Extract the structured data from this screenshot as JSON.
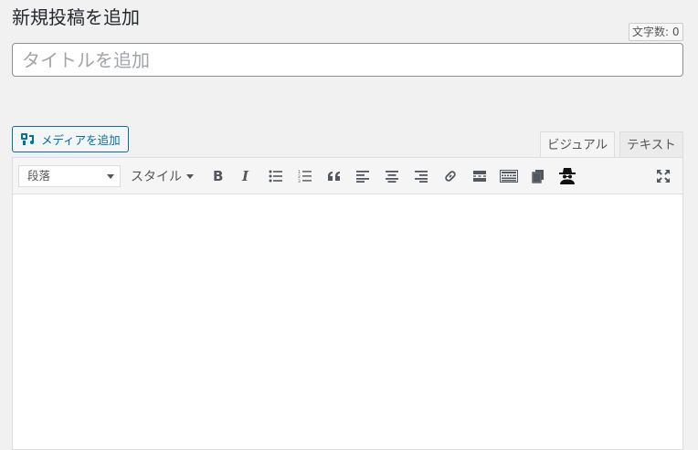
{
  "page": {
    "title": "新規投稿を追加"
  },
  "word_count": {
    "label": "文字数: 0"
  },
  "title_field": {
    "placeholder": "タイトルを追加",
    "value": ""
  },
  "media": {
    "add_media_label": "メディアを追加"
  },
  "editor_tabs": [
    {
      "label": "ビジュアル",
      "active": true
    },
    {
      "label": "テキスト",
      "active": false
    }
  ],
  "toolbar": {
    "format_select": {
      "selected": "段落"
    },
    "style_label": "スタイル",
    "buttons": [
      "bold",
      "italic",
      "bulleted-list",
      "numbered-list",
      "blockquote",
      "align-left",
      "align-center",
      "align-right",
      "insert-link",
      "read-more",
      "toolbar-toggle",
      "copy",
      "spy",
      "fullscreen"
    ]
  },
  "content": {
    "text": ""
  }
}
